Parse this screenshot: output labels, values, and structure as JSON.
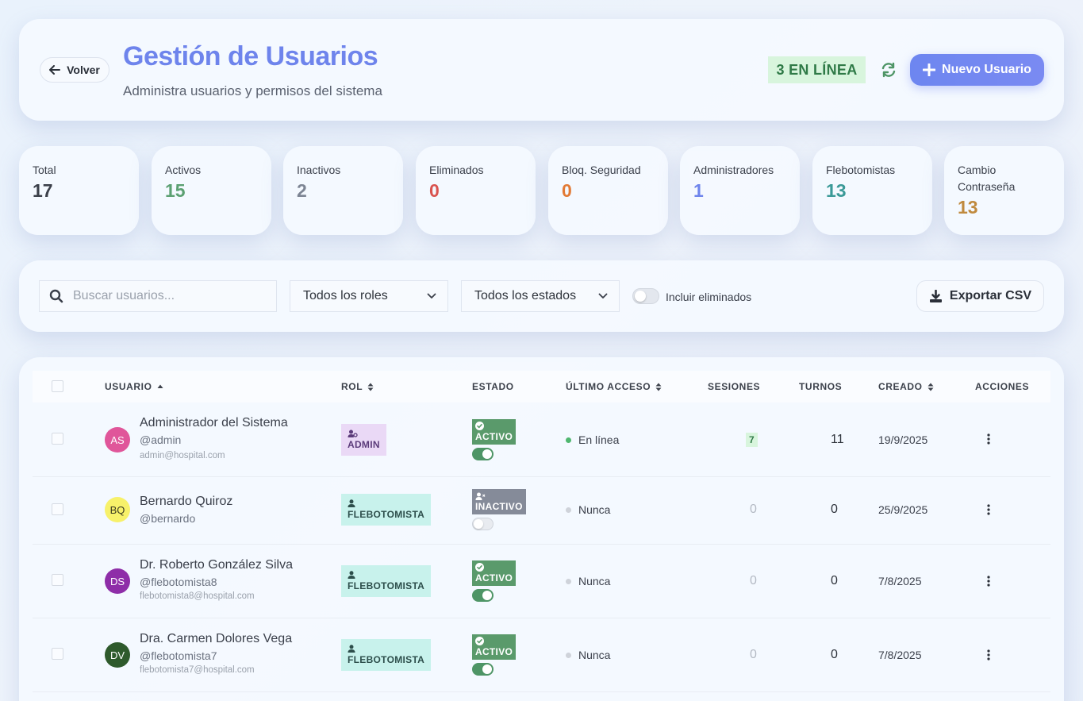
{
  "header": {
    "back_label": "Volver",
    "title": "Gestión de Usuarios",
    "subtitle": "Administra usuarios y permisos del sistema",
    "online_badge": "3 EN LÍNEA",
    "new_user_label": "Nuevo Usuario"
  },
  "stats": [
    {
      "label": "Total",
      "value": "17",
      "color": "#3b404a"
    },
    {
      "label": "Activos",
      "value": "15",
      "color": "#5ba072"
    },
    {
      "label": "Inactivos",
      "value": "2",
      "color": "#7d8594"
    },
    {
      "label": "Eliminados",
      "value": "0",
      "color": "#d9534f"
    },
    {
      "label": "Bloq. Seguridad",
      "value": "0",
      "color": "#e27a35"
    },
    {
      "label": "Administradores",
      "value": "1",
      "color": "#6e84ec"
    },
    {
      "label": "Flebotomistas",
      "value": "13",
      "color": "#3b9a98"
    },
    {
      "label": "Cambio Contraseña",
      "value": "13",
      "color": "#c08a3e"
    }
  ],
  "filters": {
    "search_placeholder": "Buscar usuarios...",
    "role_select": "Todos los roles",
    "status_select": "Todos los estados",
    "include_deleted_label": "Incluir eliminados",
    "export_label": "Exportar CSV"
  },
  "table": {
    "columns": {
      "user": "USUARIO",
      "role": "ROL",
      "status": "ESTADO",
      "last_access": "ÚLTIMO ACCESO",
      "sessions": "SESIONES",
      "turns": "TURNOS",
      "created": "CREADO",
      "actions": "ACCIONES"
    },
    "rows": [
      {
        "initials": "AS",
        "avatar_bg": "#e0569a",
        "avatar_fg": "#ffffff",
        "name": "Administrador del Sistema",
        "handle": "@admin",
        "email": "admin@hospital.com",
        "role": "ADMIN",
        "role_bg": "#ead9f6",
        "role_fg": "#5b3b7a",
        "status": "ACTIVO",
        "status_bg": "#5a9a6b",
        "enabled": true,
        "last_access": "En línea",
        "access_dot": "#4fb76f",
        "sessions": "7",
        "sessions_highlight": true,
        "turns": "11",
        "created": "19/9/2025"
      },
      {
        "initials": "BQ",
        "avatar_bg": "#f7f16a",
        "avatar_fg": "#3a3a20",
        "name": "Bernardo Quiroz",
        "handle": "@bernardo",
        "email": "",
        "role": "FLEBOTOMISTA",
        "role_bg": "#c8f2ec",
        "role_fg": "#2d4e4b",
        "status": "INACTIVO",
        "status_bg": "#858b99",
        "enabled": false,
        "last_access": "Nunca",
        "access_dot": "#cfd3da",
        "sessions": "0",
        "sessions_highlight": false,
        "turns": "0",
        "created": "25/9/2025"
      },
      {
        "initials": "DS",
        "avatar_bg": "#8e2ea8",
        "avatar_fg": "#ffffff",
        "name": "Dr. Roberto González Silva",
        "handle": "@flebotomista8",
        "email": "flebotomista8@hospital.com",
        "role": "FLEBOTOMISTA",
        "role_bg": "#c8f2ec",
        "role_fg": "#2d4e4b",
        "status": "ACTIVO",
        "status_bg": "#5a9a6b",
        "enabled": true,
        "last_access": "Nunca",
        "access_dot": "#cfd3da",
        "sessions": "0",
        "sessions_highlight": false,
        "turns": "0",
        "created": "7/8/2025"
      },
      {
        "initials": "DV",
        "avatar_bg": "#2e5a2c",
        "avatar_fg": "#ffffff",
        "name": "Dra. Carmen Dolores Vega",
        "handle": "@flebotomista7",
        "email": "flebotomista7@hospital.com",
        "role": "FLEBOTOMISTA",
        "role_bg": "#c8f2ec",
        "role_fg": "#2d4e4b",
        "status": "ACTIVO",
        "status_bg": "#5a9a6b",
        "enabled": true,
        "last_access": "Nunca",
        "access_dot": "#cfd3da",
        "sessions": "0",
        "sessions_highlight": false,
        "turns": "0",
        "created": "7/8/2025"
      }
    ]
  }
}
